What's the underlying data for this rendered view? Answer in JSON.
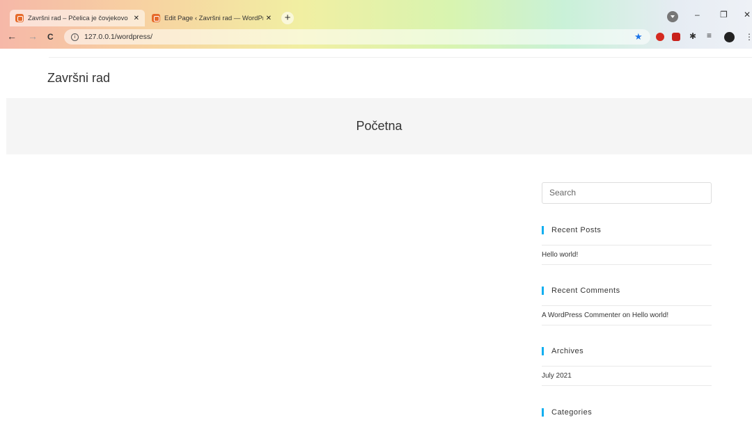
{
  "browser": {
    "tabs": [
      {
        "title": "Završni rad – Pčelica je čovjekovo",
        "active": true
      },
      {
        "title": "Edit Page ‹ Završni rad — WordPress",
        "active": false
      }
    ],
    "new_tab": "+",
    "close_glyph": "✕",
    "url": "127.0.0.1/wordpress/",
    "controls": {
      "minimize": "–",
      "restore": "❐",
      "close": "✕"
    },
    "nav": {
      "back": "←",
      "forward": "→",
      "reload": "C"
    },
    "star": "★",
    "puzzle": "✱",
    "queue": "≡",
    "kebab": "⋮"
  },
  "site": {
    "title": "Završni rad",
    "page_title": "Početna"
  },
  "sidebar": {
    "search_placeholder": "Search",
    "widgets": [
      {
        "title": "Recent Posts",
        "items": [
          "Hello world!"
        ]
      },
      {
        "title": "Recent Comments",
        "items": [
          "A WordPress Commenter on Hello world!"
        ]
      },
      {
        "title": "Archives",
        "items": [
          "July 2021"
        ]
      },
      {
        "title": "Categories",
        "items": []
      }
    ]
  },
  "colors": {
    "accent": "#13aff0",
    "hero_bg": "#f5f5f5"
  }
}
